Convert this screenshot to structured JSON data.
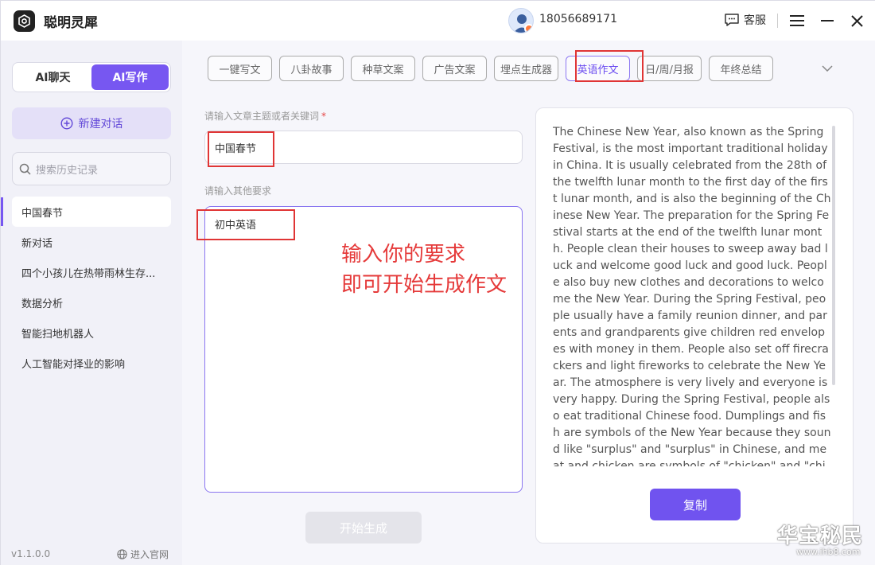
{
  "app": {
    "name": "聪明灵犀",
    "logo_icon": "app-logo-icon"
  },
  "user": {
    "phone": "18056689171"
  },
  "header": {
    "service_label": "客服"
  },
  "sidebar": {
    "modes": [
      "AI聊天",
      "AI写作"
    ],
    "active_mode": "AI写作",
    "new_chat_label": "新建对话",
    "search_placeholder": "搜索历史记录",
    "history": [
      "中国春节",
      "新对话",
      "四个小孩儿在热带雨林生存...",
      "数据分析",
      "智能扫地机器人",
      "人工智能对择业的影响"
    ],
    "active_history": "中国春节",
    "version": "v1.1.0.0",
    "website_label": "进入官网"
  },
  "tabs": [
    "一键写文",
    "八卦故事",
    "种草文案",
    "广告文案",
    "埋点生成器",
    "英语作文",
    "日/周/月报",
    "年终总结"
  ],
  "active_tab": "英语作文",
  "form": {
    "topic_label": "请输入文章主题或者关键词",
    "required_mark": "*",
    "topic_value": "中国春节",
    "requirements_label": "请输入其他要求",
    "requirements_value": "初中英语",
    "generate_label": "开始生成"
  },
  "annotation": {
    "line1": "输入你的要求",
    "line2": "即可开始生成作文"
  },
  "output": {
    "text": "The Chinese New Year, also known as the Spring Festival, is the most important traditional holiday in China. It is usually celebrated from the 28th of the twelfth lunar month to the first day of the first lunar month, and is also the beginning of the Chinese New Year. The preparation for the Spring Festival starts at the end of the twelfth lunar month. People clean their houses to sweep away bad luck and welcome good luck and good luck. People also buy new clothes and decorations to welcome the New Year. During the Spring Festival, people usually have a family reunion dinner, and parents and grandparents give children red envelopes with money in them. People also set off firecrackers and light fireworks to celebrate the New Year. The atmosphere is very lively and everyone is very happy. During the Spring Festival, people also eat traditional Chinese food. Dumplings and fish are symbols of the New Year because they sound like \"surplus\" and \"surplus\" in Chinese, and meat and chicken are symbols of \"chicken\" and \"chicken\", which sound like \"good luck\" and \"good luck\" in",
    "copy_label": "复制"
  },
  "watermark": {
    "text": "华宝秘民",
    "url": "www.ihb8.com"
  },
  "colors": {
    "accent": "#7757f1",
    "annotation_red": "#e53a3a"
  }
}
